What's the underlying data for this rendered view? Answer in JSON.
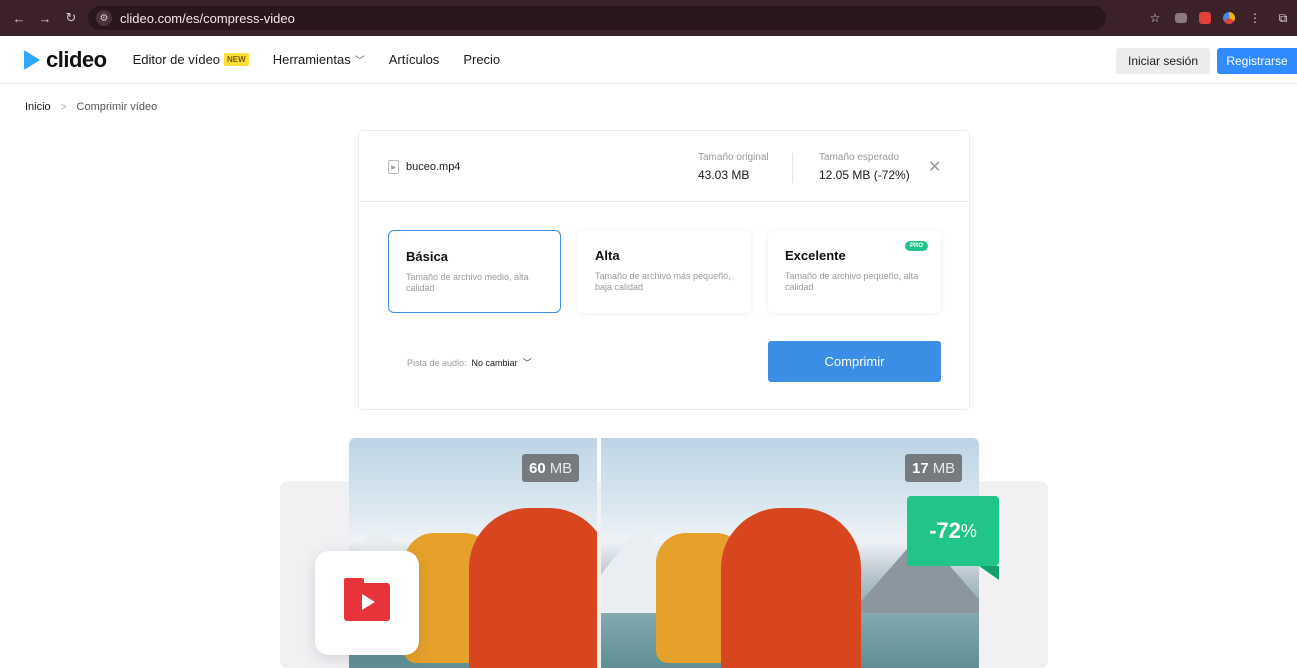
{
  "browser": {
    "url": "clideo.com/es/compress-video"
  },
  "header": {
    "logo_text": "clideo",
    "nav": [
      {
        "label": "Editor de vídeo",
        "badge": "NEW"
      },
      {
        "label": "Herramientas",
        "has_dropdown": true
      },
      {
        "label": "Artículos"
      },
      {
        "label": "Precio"
      }
    ],
    "login_label": "Iniciar sesión",
    "register_label": "Registrarse"
  },
  "breadcrumb": {
    "home": "Inicio",
    "separator": ">",
    "current": "Comprimir vídeo"
  },
  "file": {
    "name": "buceo.mp4",
    "original_label": "Tamaño original",
    "original_value": "43.03 MB",
    "expected_label": "Tamaño esperado",
    "expected_value": "12.05 MB (-72%)"
  },
  "options": [
    {
      "title": "Básica",
      "desc": "Tamaño de archivo medio, alta calidad",
      "selected": true
    },
    {
      "title": "Alta",
      "desc": "Tamaño de archivo más pequeño, baja calidad",
      "selected": false
    },
    {
      "title": "Excelente",
      "desc": "Tamaño de archivo pequeño, alta calidad",
      "selected": false,
      "badge": "PRO"
    }
  ],
  "audio": {
    "label": "Pista de audio:",
    "value": "No cambiar"
  },
  "compress_label": "Comprimir",
  "promo": {
    "before_size": "60",
    "after_size": "17",
    "unit": "MB",
    "reduction": "-72",
    "reduction_symbol": "%"
  },
  "colors": {
    "accent": "#3a8ee6",
    "register": "#2f8bff",
    "pro": "#21c58a",
    "folder": "#e8333a",
    "chrome": "#3b2228"
  }
}
